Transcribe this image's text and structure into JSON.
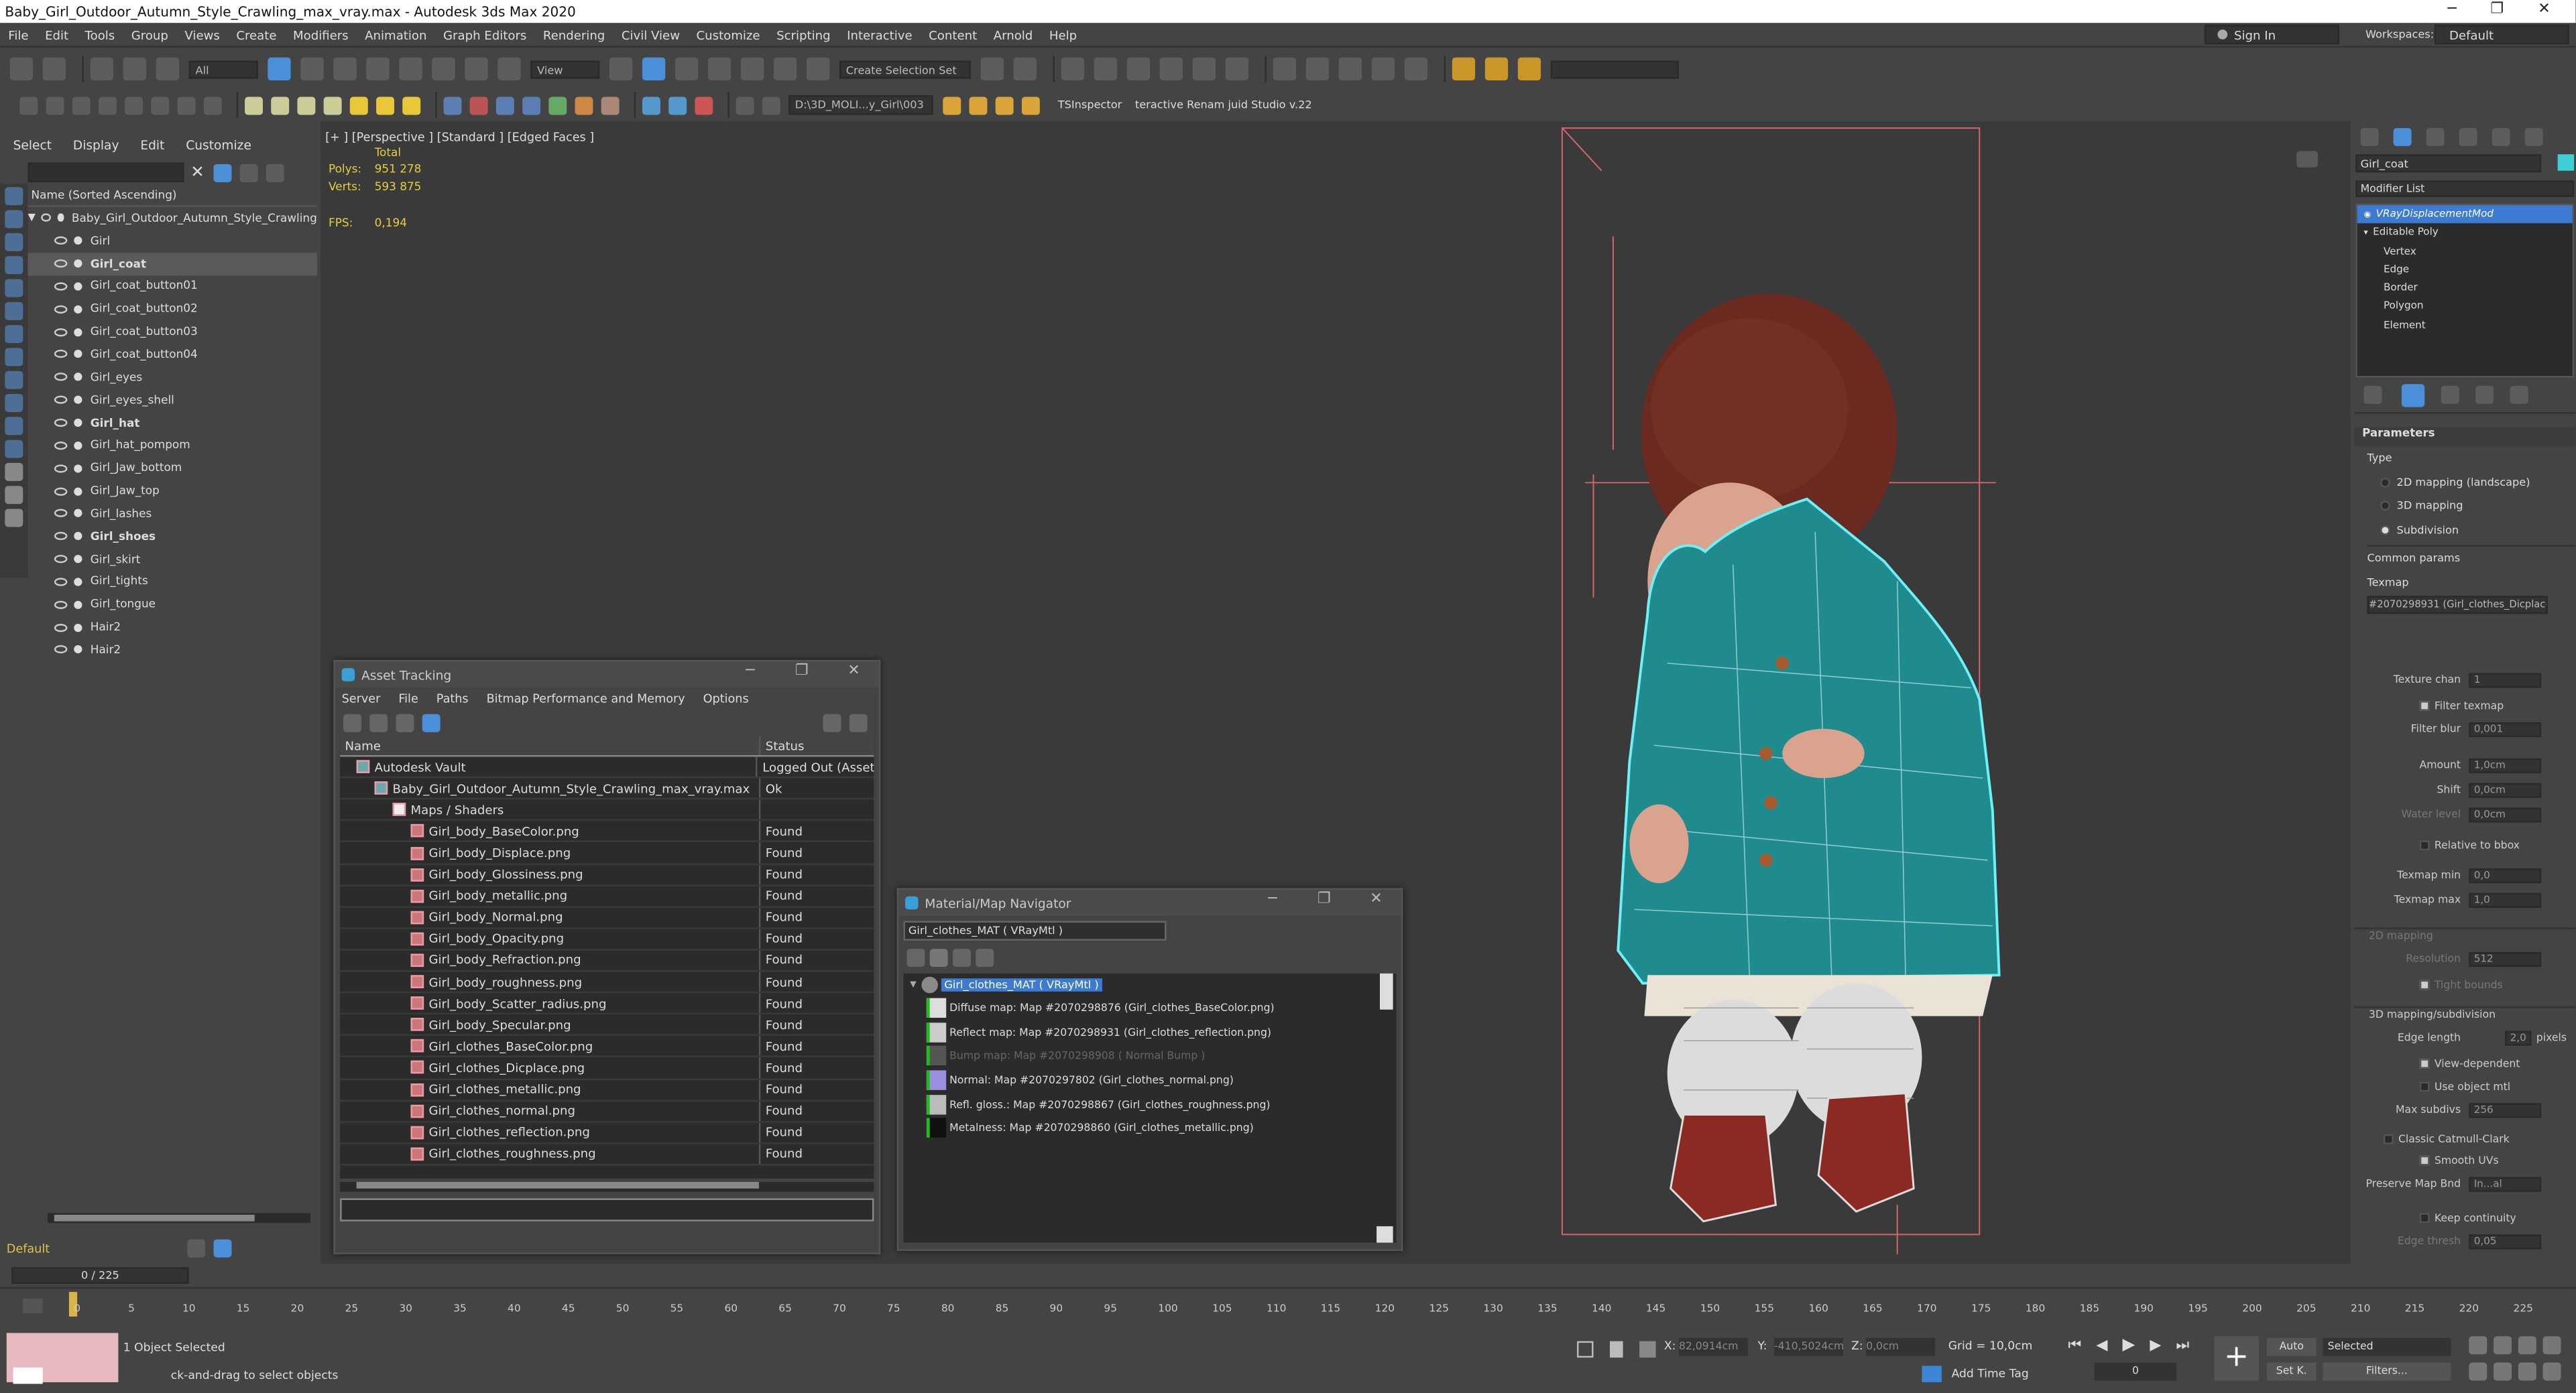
{
  "window": {
    "title": "Baby_Girl_Outdoor_Autumn_Style_Crawling_max_vray.max - Autodesk 3ds Max 2020",
    "controls": [
      "─",
      "❐",
      "✕"
    ]
  },
  "menu": [
    "File",
    "Edit",
    "Tools",
    "Group",
    "Views",
    "Create",
    "Modifiers",
    "Animation",
    "Graph Editors",
    "Rendering",
    "Civil View",
    "Customize",
    "Scripting",
    "Interactive",
    "Content",
    "Arnold",
    "Help"
  ],
  "account": {
    "sign_in": "Sign In",
    "workspaces_label": "Workspaces:",
    "workspace": "Default"
  },
  "toolbar": {
    "filter": "All",
    "view": "View",
    "selection_set": "Create Selection Set",
    "path": "D:\\3D_MOLI...y_Girl\\003",
    "ts_inspector": "TSInspector",
    "renamer": "teractive Renam juid Studio v.22"
  },
  "scene_explorer": {
    "tabs": [
      "Select",
      "Display",
      "Edit",
      "Customize"
    ],
    "header": "Name (Sorted Ascending)",
    "root": "Baby_Girl_Outdoor_Autumn_Style_Crawling",
    "items": [
      {
        "name": "Girl",
        "bold": false,
        "selected": false
      },
      {
        "name": "Girl_coat",
        "bold": true,
        "selected": true
      },
      {
        "name": "Girl_coat_button01",
        "bold": false,
        "selected": false
      },
      {
        "name": "Girl_coat_button02",
        "bold": false,
        "selected": false
      },
      {
        "name": "Girl_coat_button03",
        "bold": false,
        "selected": false
      },
      {
        "name": "Girl_coat_button04",
        "bold": false,
        "selected": false
      },
      {
        "name": "Girl_eyes",
        "bold": false,
        "selected": false
      },
      {
        "name": "Girl_eyes_shell",
        "bold": false,
        "selected": false
      },
      {
        "name": "Girl_hat",
        "bold": true,
        "selected": false
      },
      {
        "name": "Girl_hat_pompom",
        "bold": false,
        "selected": false
      },
      {
        "name": "Girl_Jaw_bottom",
        "bold": false,
        "selected": false
      },
      {
        "name": "Girl_Jaw_top",
        "bold": false,
        "selected": false
      },
      {
        "name": "Girl_lashes",
        "bold": false,
        "selected": false
      },
      {
        "name": "Girl_shoes",
        "bold": true,
        "selected": false
      },
      {
        "name": "Girl_skirt",
        "bold": false,
        "selected": false
      },
      {
        "name": "Girl_tights",
        "bold": false,
        "selected": false
      },
      {
        "name": "Girl_tongue",
        "bold": false,
        "selected": false
      },
      {
        "name": "Hair2",
        "bold": false,
        "selected": false
      },
      {
        "name": "Hair2",
        "bold": false,
        "selected": false
      }
    ],
    "layer": "Default"
  },
  "viewport": {
    "label": "[+ ] [Perspective ] [Standard ] [Edged Faces ]",
    "total": "Total",
    "polys_label": "Polys:",
    "polys": "951 278",
    "verts_label": "Verts:",
    "verts": "593 875",
    "fps_label": "FPS:",
    "fps": "0,194"
  },
  "asset_tracking": {
    "title": "Asset Tracking",
    "menu": [
      "Server",
      "File",
      "Paths",
      "Bitmap Performance and Memory",
      "Options"
    ],
    "col_name": "Name",
    "col_status": "Status",
    "rows": [
      {
        "name": "Autodesk Vault",
        "status": "Logged Out (Asset",
        "indent": 0,
        "type": "vault"
      },
      {
        "name": "Baby_Girl_Outdoor_Autumn_Style_Crawling_max_vray.max",
        "status": "Ok",
        "indent": 1,
        "type": "max"
      },
      {
        "name": "Maps / Shaders",
        "status": "",
        "indent": 2,
        "type": "folder"
      },
      {
        "name": "Girl_body_BaseColor.png",
        "status": "Found",
        "indent": 3,
        "type": "file"
      },
      {
        "name": "Girl_body_Displace.png",
        "status": "Found",
        "indent": 3,
        "type": "file"
      },
      {
        "name": "Girl_body_Glossiness.png",
        "status": "Found",
        "indent": 3,
        "type": "file"
      },
      {
        "name": "Girl_body_metallic.png",
        "status": "Found",
        "indent": 3,
        "type": "file"
      },
      {
        "name": "Girl_body_Normal.png",
        "status": "Found",
        "indent": 3,
        "type": "file"
      },
      {
        "name": "Girl_body_Opacity.png",
        "status": "Found",
        "indent": 3,
        "type": "file"
      },
      {
        "name": "Girl_body_Refraction.png",
        "status": "Found",
        "indent": 3,
        "type": "file"
      },
      {
        "name": "Girl_body_roughness.png",
        "status": "Found",
        "indent": 3,
        "type": "file"
      },
      {
        "name": "Girl_body_Scatter_radius.png",
        "status": "Found",
        "indent": 3,
        "type": "file"
      },
      {
        "name": "Girl_body_Specular.png",
        "status": "Found",
        "indent": 3,
        "type": "file"
      },
      {
        "name": "Girl_clothes_BaseColor.png",
        "status": "Found",
        "indent": 3,
        "type": "file"
      },
      {
        "name": "Girl_clothes_Dicplace.png",
        "status": "Found",
        "indent": 3,
        "type": "file"
      },
      {
        "name": "Girl_clothes_metallic.png",
        "status": "Found",
        "indent": 3,
        "type": "file"
      },
      {
        "name": "Girl_clothes_normal.png",
        "status": "Found",
        "indent": 3,
        "type": "file"
      },
      {
        "name": "Girl_clothes_reflection.png",
        "status": "Found",
        "indent": 3,
        "type": "file"
      },
      {
        "name": "Girl_clothes_roughness.png",
        "status": "Found",
        "indent": 3,
        "type": "file"
      }
    ]
  },
  "mat_nav": {
    "title": "Material/Map Navigator",
    "current": "Girl_clothes_MAT  ( VRayMtl )",
    "root": "Girl_clothes_MAT  ( VRayMtl )",
    "maps": [
      {
        "label": "Diffuse map: Map #2070298876 (Girl_clothes_BaseColor.png)",
        "dim": false,
        "color": "#ddd"
      },
      {
        "label": "Reflect map: Map #2070298931 (Girl_clothes_reflection.png)",
        "dim": false,
        "color": "#ccc"
      },
      {
        "label": "Bump map: Map #2070298908  ( Normal Bump )",
        "dim": true,
        "color": "#555"
      },
      {
        "label": "Normal: Map #2070297802 (Girl_clothes_normal.png)",
        "dim": false,
        "color": "#9a8ee0"
      },
      {
        "label": "Refl. gloss.: Map #2070298867 (Girl_clothes_roughness.png)",
        "dim": false,
        "color": "#bbb"
      },
      {
        "label": "Metalness: Map #2070298860 (Girl_clothes_metallic.png)",
        "dim": false,
        "color": "#111"
      }
    ]
  },
  "command_panel": {
    "object_name": "Girl_coat",
    "modifier_list": "Modifier List",
    "stack": [
      {
        "name": "VRayDisplacementMod",
        "level": 0,
        "selected": true
      },
      {
        "name": "Editable Poly",
        "level": 0,
        "selected": false
      },
      {
        "name": "Vertex",
        "level": 1,
        "selected": false
      },
      {
        "name": "Edge",
        "level": 1,
        "selected": false
      },
      {
        "name": "Border",
        "level": 1,
        "selected": false
      },
      {
        "name": "Polygon",
        "level": 1,
        "selected": false
      },
      {
        "name": "Element",
        "level": 1,
        "selected": false
      }
    ],
    "parameters": "Parameters",
    "type_label": "Type",
    "types": [
      "2D mapping (landscape)",
      "3D mapping",
      "Subdivision"
    ],
    "common": "Common params",
    "texmap": "Texmap",
    "texmap_value": "#2070298931 (Girl_clothes_Dicplace",
    "texture_chan": "Texture chan",
    "texture_chan_v": "1",
    "filter_texmap": "Filter texmap",
    "filter_blur": "Filter blur",
    "filter_blur_v": "0,001",
    "amount": "Amount",
    "amount_v": "1,0cm",
    "shift": "Shift",
    "shift_v": "0,0cm",
    "water_level": "Water level",
    "water_level_v": "0,0cm",
    "relative_bbox": "Relative to bbox",
    "texmap_min": "Texmap min",
    "texmap_min_v": "0,0",
    "texmap_max": "Texmap max",
    "texmap_max_v": "1,0",
    "mapping2d": "2D mapping",
    "resolution": "Resolution",
    "resolution_v": "512",
    "tight_bounds": "Tight bounds",
    "mapping3d": "3D mapping/subdivision",
    "edge_length": "Edge length",
    "edge_length_v": "2,0",
    "pixels": "pixels",
    "view_dependent": "View-dependent",
    "use_object_mtl": "Use object mtl",
    "max_subdivs": "Max subdivs",
    "max_subdivs_v": "256",
    "catmull": "Classic Catmull-Clark",
    "smooth_uvs": "Smooth UVs",
    "preserve": "Preserve Map Bnd",
    "preserve_v": "In...al",
    "keep_continuity": "Keep continuity",
    "edge_thresh": "Edge thresh",
    "edge_thresh_v": "0,05"
  },
  "timeline": {
    "frame": "0 / 225",
    "ticks": [
      "0",
      "5",
      "10",
      "15",
      "20",
      "25",
      "30",
      "35",
      "40",
      "45",
      "50",
      "55",
      "60",
      "65",
      "70",
      "75",
      "80",
      "85",
      "90",
      "95",
      "100",
      "105",
      "110",
      "115",
      "120",
      "125",
      "130",
      "135",
      "140",
      "145",
      "150",
      "155",
      "160",
      "165",
      "170",
      "175",
      "180",
      "185",
      "190",
      "195",
      "200",
      "205",
      "210",
      "215",
      "220",
      "225"
    ],
    "status": "1 Object Selected",
    "prompt": "ck-and-drag to select objects",
    "x_label": "X:",
    "x": "82,0914cm",
    "y_label": "Y:",
    "y": "-410,5024cm",
    "z_label": "Z:",
    "z": "0,0cm",
    "grid": "Grid = 10,0cm",
    "add_time_tag": "Add Time Tag",
    "auto": "Auto",
    "set_k": "Set K.",
    "selected": "Selected",
    "filters": "Filters...",
    "frame_field": "0"
  }
}
